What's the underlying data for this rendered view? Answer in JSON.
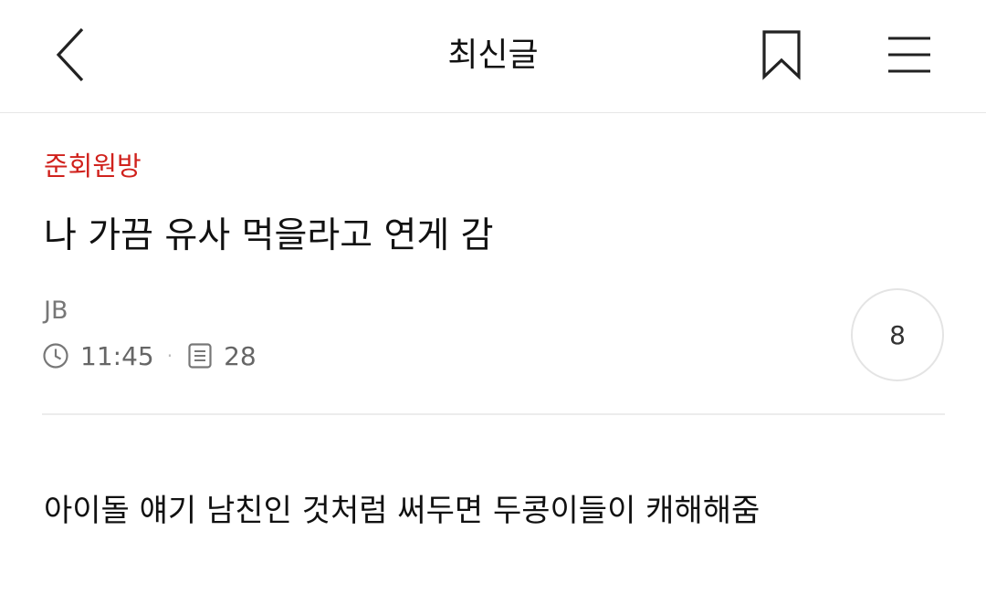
{
  "header": {
    "title": "최신글",
    "back_icon": "chevron-left-icon",
    "bookmark_icon": "bookmark-icon",
    "menu_icon": "hamburger-menu-icon"
  },
  "post": {
    "board": "준회원방",
    "title": "나 가끔 유사 먹을라고 연게 감",
    "author": "JB",
    "time": "11:45",
    "separator": "·",
    "views": "28",
    "comment_count": "8",
    "body": "아이돌 얘기 남친인 것처럼 써두면 두콩이들이 캐해해줌"
  },
  "colors": {
    "accent": "#d0211c",
    "meta_text": "#666666",
    "divider": "#ececec"
  }
}
